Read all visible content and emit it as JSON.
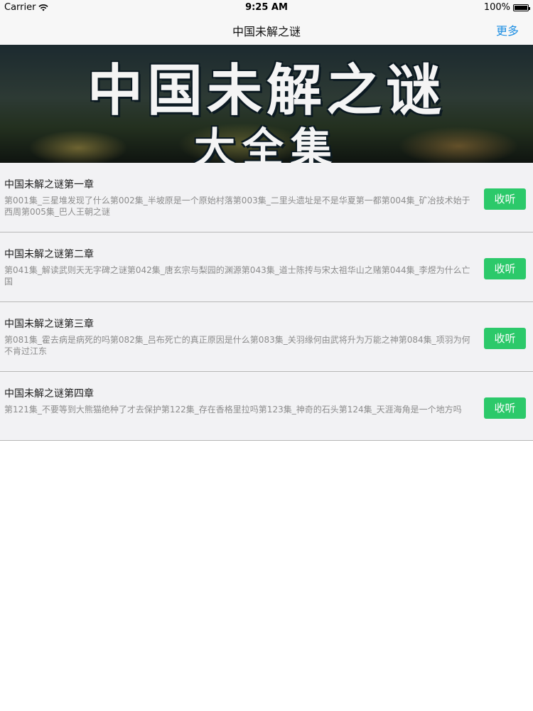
{
  "status_bar": {
    "carrier": "Carrier",
    "time": "9:25 AM",
    "battery": "100%"
  },
  "nav": {
    "title": "中国未解之谜",
    "more_label": "更多"
  },
  "banner": {
    "title": "中国未解之谜",
    "subtitle": "大全集"
  },
  "chapters": [
    {
      "title": "中国未解之谜第一章",
      "description": "第001集_三星堆发现了什么第002集_半坡原是一个原始村落第003集_二里头遗址是不是华夏第一都第004集_矿冶技术始于西周第005集_巴人王朝之谜",
      "button_label": "收听"
    },
    {
      "title": "中国未解之谜第二章",
      "description": "第041集_解读武则天无字碑之谜第042集_唐玄宗与梨园的渊源第043集_道士陈抟与宋太祖华山之赌第044集_李煜为什么亡国",
      "button_label": "收听"
    },
    {
      "title": "中国未解之谜第三章",
      "description": "第081集_霍去病是病死的吗第082集_吕布死亡的真正原因是什么第083集_关羽缘何由武将升为万能之神第084集_项羽为何不肯过江东",
      "button_label": "收听"
    },
    {
      "title": "中国未解之谜第四章",
      "description": "第121集_不要等到大熊猫绝种了才去保护第122集_存在香格里拉吗第123集_神奇的石头第124集_天涯海角是一个地方吗",
      "button_label": "收听"
    }
  ],
  "colors": {
    "accent": "#1e8fe3",
    "listen_button": "#2cc96a",
    "row_background": "#f2f2f4"
  },
  "icons": [
    "wifi-icon",
    "battery-icon"
  ]
}
